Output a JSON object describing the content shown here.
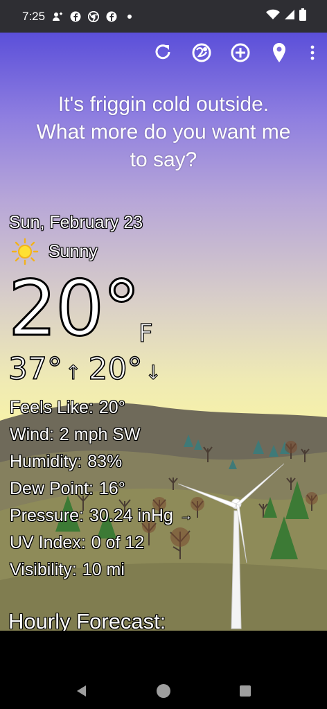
{
  "status_bar": {
    "time": "7:25",
    "left_icons": [
      "person-add-icon",
      "facebook-icon",
      "chrome-icon",
      "facebook-icon",
      "dot-icon"
    ],
    "right_icons": [
      "wifi-icon",
      "cell-signal-icon",
      "battery-icon"
    ]
  },
  "toolbar": {
    "icons": [
      "refresh-icon",
      "radar-icon",
      "add-location-icon",
      "location-pin-icon",
      "more-vert-icon"
    ]
  },
  "headline": {
    "line1": "It's friggin cold outside.",
    "line2": "What more do you want me",
    "line3": "to say?"
  },
  "weather": {
    "date": "Sun, February 23",
    "condition": "Sunny",
    "condition_icon": "sun-icon",
    "temperature": "20°",
    "unit": "F",
    "high": "37°",
    "low": "20°"
  },
  "details": {
    "feels_like_label": "Feels Like:",
    "feels_like_value": "20°",
    "wind_label": "Wind:",
    "wind_value": "2 mph SW",
    "humidity_label": "Humidity:",
    "humidity_value": "83%",
    "dew_point_label": "Dew Point:",
    "dew_point_value": "16°",
    "pressure_label": "Pressure:",
    "pressure_value": "30.24 inHg",
    "pressure_trend": "→",
    "uv_label": "UV Index:",
    "uv_value": "0 of 12",
    "visibility_label": "Visibility:",
    "visibility_value": "10 mi"
  },
  "hourly": {
    "title": "Hourly Forecast:"
  },
  "colors": {
    "sky_top": "#5b4fd9",
    "sky_bottom": "#f7f2a8",
    "hill_far": "#6f6a5a",
    "hill_near": "#8c8a58",
    "status_bar": "#2e2e33"
  }
}
